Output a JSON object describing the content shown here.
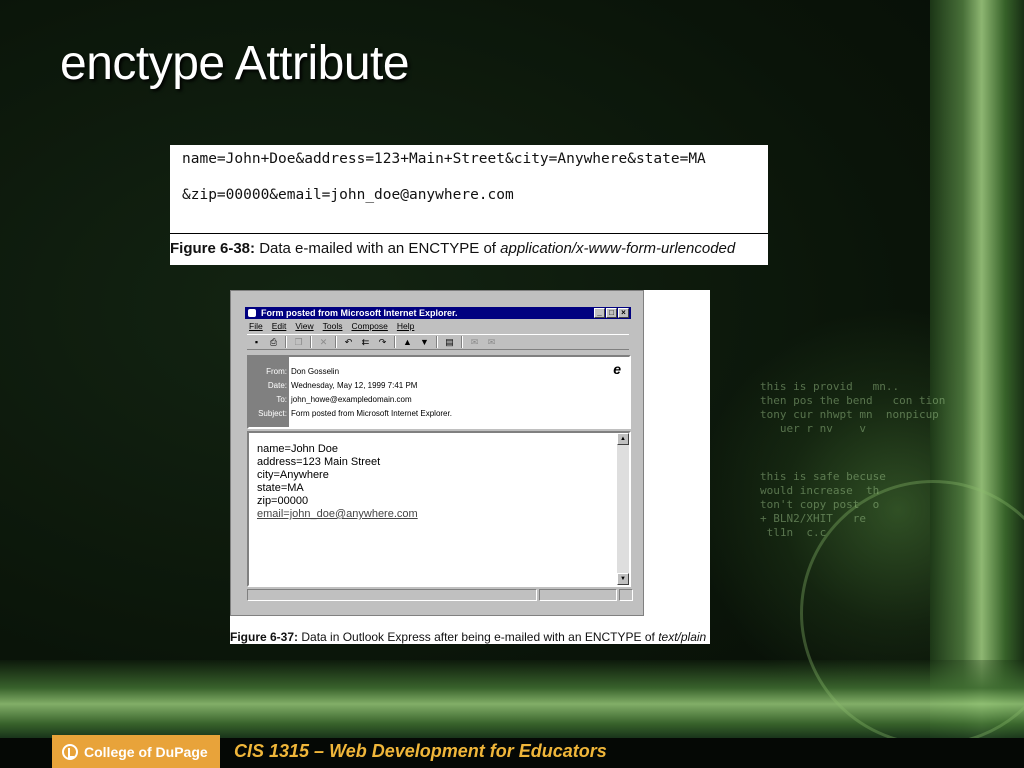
{
  "slide": {
    "title": "enctype Attribute"
  },
  "figure1": {
    "code_line_1": "name=John+Doe&address=123+Main+Street&city=Anywhere&state=MA",
    "code_line_2": "&zip=00000&email=john_doe@anywhere.com",
    "caption_label": "Figure 6-38:",
    "caption_text": " Data e-mailed with an ENCTYPE of ",
    "caption_em": "application/x-www-form-urlencoded"
  },
  "figure2": {
    "window_title": "Form posted from Microsoft Internet Explorer.",
    "menu": [
      "File",
      "Edit",
      "View",
      "Tools",
      "Compose",
      "Help"
    ],
    "toolbar_icons": [
      "save-icon",
      "print-icon",
      "copy-icon",
      "delete-icon",
      "reply-icon",
      "reply-all-icon",
      "forward-icon",
      "previous-icon",
      "next-icon",
      "address-book-icon",
      "send-icon",
      "receive-icon"
    ],
    "header": {
      "from_label": "From:",
      "from_value": "Don Gosselin",
      "date_label": "Date:",
      "date_value": "Wednesday, May 12, 1999 7:41 PM",
      "to_label": "To:",
      "to_value": "john_howe@exampledomain.com",
      "subject_label": "Subject:",
      "subject_value": "Form posted from Microsoft Internet Explorer."
    },
    "body_lines": [
      "name=John Doe",
      "address=123 Main Street",
      "city=Anywhere",
      "state=MA",
      "zip=00000"
    ],
    "body_link": "email=john_doe@anywhere.com",
    "caption_label": "Figure 6-37:",
    "caption_text": " Data in Outlook Express after being e-mailed with an ENCTYPE of ",
    "caption_em": "text/plain"
  },
  "footer": {
    "logo_text": "College of DuPage",
    "course_text": "CIS 1315 – Web Development for Educators"
  },
  "colors": {
    "accent": "#e8a33a",
    "course_text": "#f0b63a",
    "titlebar": "#000080"
  }
}
